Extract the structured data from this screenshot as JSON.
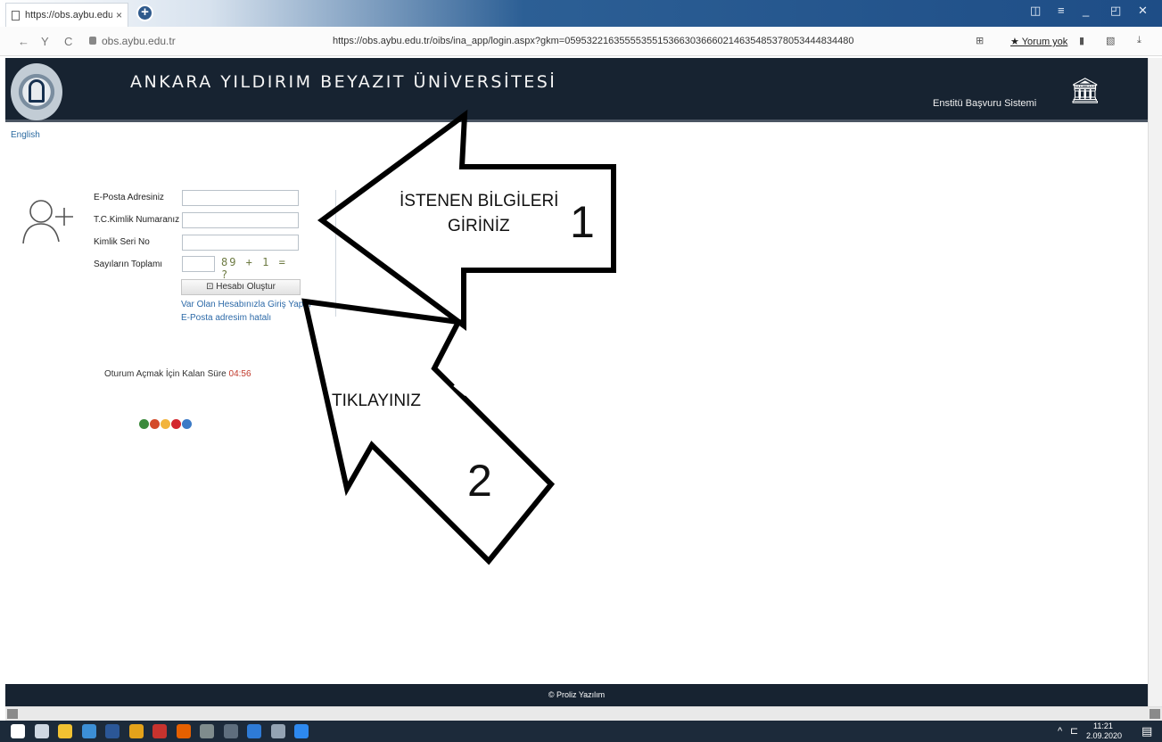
{
  "browser": {
    "tab_title": "https://obs.aybu.edu.tr/",
    "tab_close": "×",
    "new_tab": "+",
    "domain": "obs.aybu.edu.tr",
    "url": "https://obs.aybu.edu.tr/oibs/ina_app/login.aspx?gkm=05953221635555355153663036660214635485378053444834480",
    "review_label": "★ Yorum yok",
    "nav": {
      "back": "←",
      "forward": "Y",
      "refresh": "C"
    }
  },
  "header": {
    "university_name": "ANKARA YILDIRIM BEYAZIT ÜNİVERSİTESİ",
    "system_name": "Enstitü Başvuru Sistemi",
    "building_icon": "institution-icon"
  },
  "language_link": "English",
  "form": {
    "fields": [
      {
        "label": "E-Posta Adresiniz",
        "value": "",
        "placeholder": ""
      },
      {
        "label": "T.C.Kimlik Numaranız",
        "value": "",
        "placeholder": ""
      },
      {
        "label": "Kimlik Seri No",
        "value": "",
        "placeholder": ""
      },
      {
        "label": "Sayıların Toplamı",
        "value": "",
        "placeholder": ""
      }
    ],
    "captcha_text": "89 + 1 = ?",
    "create_button": "Hesabı Oluştur",
    "login_link": "Var Olan Hesabınızla Giriş Yapın",
    "email_error_link": "E-Posta adresim hatalı"
  },
  "session": {
    "label": "Oturum Açmak İçin Kalan Süre",
    "countdown": "04:56"
  },
  "browser_icons": [
    {
      "name": "browser-icon-1",
      "color": "#3b8a3c"
    },
    {
      "name": "browser-icon-2",
      "color": "#d34b2a"
    },
    {
      "name": "browser-icon-3",
      "color": "#f2b43c"
    },
    {
      "name": "browser-icon-4",
      "color": "#d3262e"
    },
    {
      "name": "browser-icon-5",
      "color": "#3c7ac6"
    }
  ],
  "annotations": {
    "arrow1_text_line1": "İSTENEN BİLGİLERİ",
    "arrow1_text_line2": "GİRİNİZ",
    "arrow1_number": "1",
    "arrow2_text": "TIKLAYINIZ",
    "arrow2_number": "2"
  },
  "footer": "© Proliz Yazılım",
  "taskbar": {
    "time": "11:21",
    "date": "2.09.2020",
    "icons": [
      {
        "name": "windows-start-icon",
        "color": "#ffffff"
      },
      {
        "name": "task-view-icon",
        "color": "#cfd8e3"
      },
      {
        "name": "file-explorer-icon",
        "color": "#f1c232"
      },
      {
        "name": "edge-icon",
        "color": "#3c8fd6"
      },
      {
        "name": "word-icon",
        "color": "#2b5797"
      },
      {
        "name": "chrome-icon",
        "color": "#e3a21a"
      },
      {
        "name": "yandex-icon",
        "color": "#c7332e"
      },
      {
        "name": "firefox-icon",
        "color": "#e66000"
      },
      {
        "name": "app-icon",
        "color": "#7f8c8d"
      },
      {
        "name": "calculator-icon",
        "color": "#5e6e7e"
      },
      {
        "name": "drop-icon",
        "color": "#2e7bd6"
      },
      {
        "name": "settings-icon",
        "color": "#93a3b3"
      },
      {
        "name": "photos-icon",
        "color": "#2d89ef"
      }
    ]
  }
}
